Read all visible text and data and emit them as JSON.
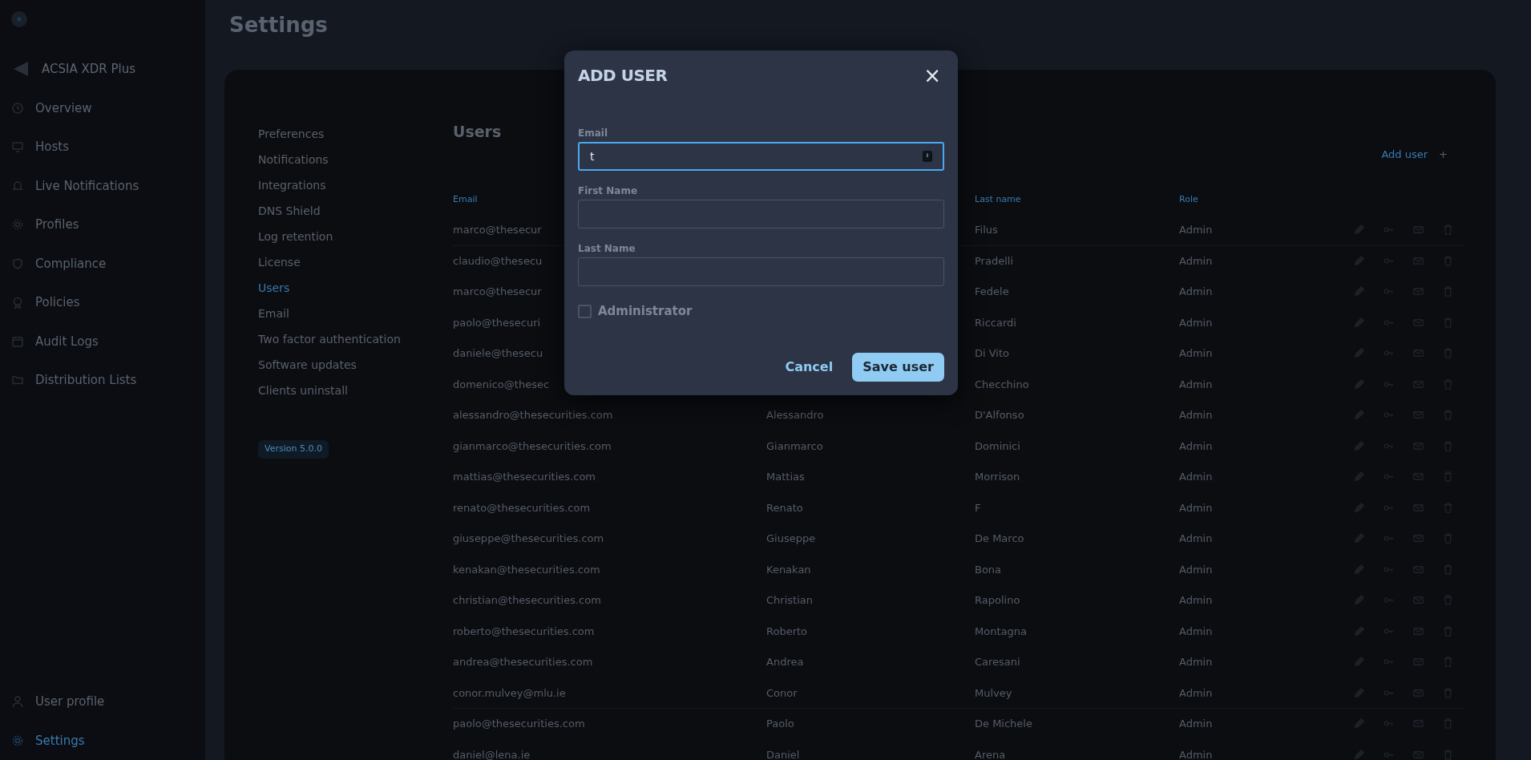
{
  "sidebar": {
    "logo_text": "ACSIA XDR Plus",
    "items": [
      {
        "label": "Overview",
        "selected": false
      },
      {
        "label": "Hosts",
        "selected": false
      },
      {
        "label": "Live Notifications",
        "selected": false
      },
      {
        "label": "Profiles",
        "selected": false
      },
      {
        "label": "Compliance",
        "selected": false
      },
      {
        "label": "Policies",
        "selected": false
      },
      {
        "label": "Audit Logs",
        "selected": false
      },
      {
        "label": "Distribution Lists",
        "selected": false
      }
    ],
    "bottom_items": [
      {
        "label": "User profile",
        "selected": false
      },
      {
        "label": "Settings",
        "selected": true
      }
    ]
  },
  "page": {
    "title": "Settings"
  },
  "settings_nav": {
    "items": [
      {
        "label": "Preferences",
        "selected": false
      },
      {
        "label": "Notifications",
        "selected": false
      },
      {
        "label": "Integrations",
        "selected": false
      },
      {
        "label": "DNS Shield",
        "selected": false
      },
      {
        "label": "Log retention",
        "selected": false
      },
      {
        "label": "License",
        "selected": false
      },
      {
        "label": "Users",
        "selected": true
      },
      {
        "label": "Email",
        "selected": false
      },
      {
        "label": "Two factor authentication",
        "selected": false
      },
      {
        "label": "Software updates",
        "selected": false
      },
      {
        "label": "Clients uninstall",
        "selected": false
      }
    ],
    "version": "Version 5.0.0"
  },
  "users": {
    "title": "Users",
    "add_label": "Add user",
    "add_icon": "+",
    "columns": {
      "email": "Email",
      "last_name": "Last name",
      "role": "Role"
    },
    "rows": [
      {
        "email": "marco@thesecur",
        "last_name": "Filus",
        "role": "Admin"
      },
      {
        "email": "claudio@thesecu",
        "last_name": "Pradelli",
        "role": "Admin"
      },
      {
        "email": "marco@thesecur",
        "last_name": "Fedele",
        "role": "Admin"
      },
      {
        "email": "paolo@thesecuri",
        "last_name": "Riccardi",
        "role": "Admin"
      },
      {
        "email": "daniele@thesecu",
        "last_name": "Di Vito",
        "role": "Admin"
      },
      {
        "email": "domenico@thesec",
        "last_name": "Checchino",
        "role": "Admin"
      },
      {
        "email": "alessandro@thesecurities.com",
        "first_name": "Alessandro",
        "last_name": "D'Alfonso",
        "role": "Admin"
      },
      {
        "email": "gianmarco@thesecurities.com",
        "first_name": "Gianmarco",
        "last_name": "Dominici",
        "role": "Admin"
      },
      {
        "email": "mattias@thesecurities.com",
        "first_name": "Mattias",
        "last_name": "Morrison",
        "role": "Admin"
      },
      {
        "email": "renato@thesecurities.com",
        "first_name": "Renato",
        "last_name": "F",
        "role": "Admin"
      },
      {
        "email": "giuseppe@thesecurities.com",
        "first_name": "Giuseppe",
        "last_name": "De Marco",
        "role": "Admin"
      },
      {
        "email": "kenakan@thesecurities.com",
        "first_name": "Kenakan",
        "last_name": "Bona",
        "role": "Admin"
      },
      {
        "email": "christian@thesecurities.com",
        "first_name": "Christian",
        "last_name": "Rapolino",
        "role": "Admin"
      },
      {
        "email": "roberto@thesecurities.com",
        "first_name": "Roberto",
        "last_name": "Montagna",
        "role": "Admin"
      },
      {
        "email": "andrea@thesecurities.com",
        "first_name": "Andrea",
        "last_name": "Caresani",
        "role": "Admin"
      },
      {
        "email": "conor.mulvey@mlu.ie",
        "first_name": "Conor",
        "last_name": "Mulvey",
        "role": "Admin"
      },
      {
        "email": "paolo@thesecurities.com",
        "first_name": "Paolo",
        "last_name": "De Michele",
        "role": "Admin"
      },
      {
        "email": "daniel@lena.ie",
        "first_name": "Daniel",
        "last_name": "Arena",
        "role": "Admin"
      }
    ]
  },
  "modal": {
    "title": "ADD USER",
    "close": "×",
    "fields": [
      {
        "label": "Email",
        "value": "t",
        "focused": true
      },
      {
        "label": "First Name",
        "focused": false
      },
      {
        "label": "Last Name",
        "focused": false
      }
    ],
    "checkbox": {
      "label": "Administrator",
      "checked": false
    },
    "buttons": [
      {
        "label": "Cancel",
        "kind": "link"
      },
      {
        "label": "Save user",
        "kind": "primary"
      }
    ]
  }
}
